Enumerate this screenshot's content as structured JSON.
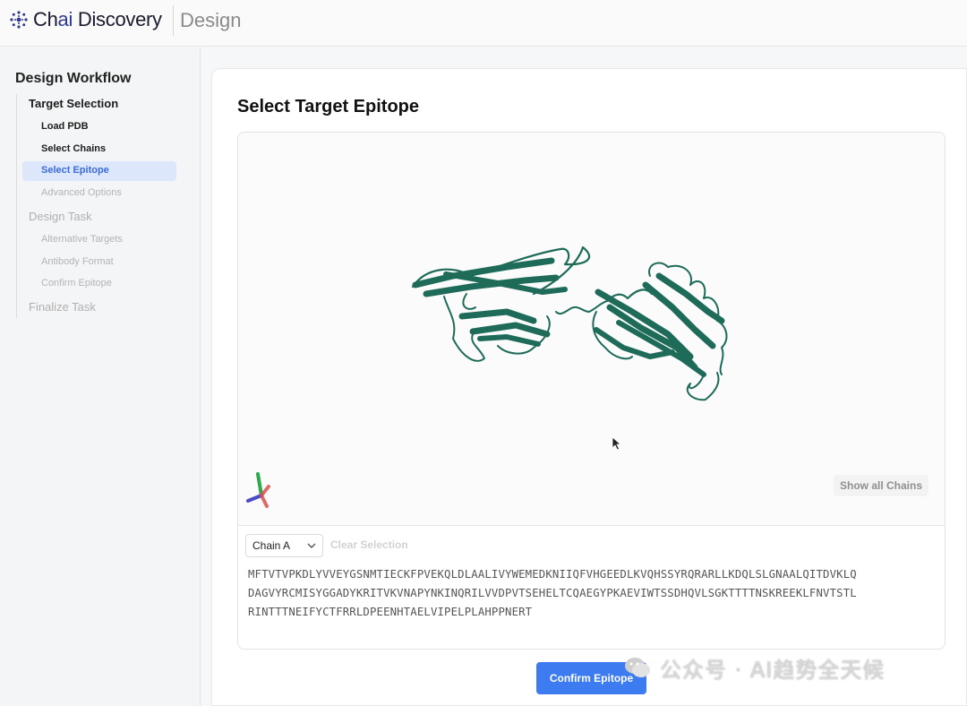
{
  "header": {
    "brand_prefix": "Ch",
    "brand_highlight": "ai",
    "brand_suffix": " Discovery",
    "section": "Design"
  },
  "sidebar": {
    "title": "Design Workflow",
    "sections": [
      {
        "label": "Target Selection",
        "state": "done"
      },
      {
        "label": "Design Task",
        "state": "pending"
      },
      {
        "label": "Finalize Task",
        "state": "pending"
      }
    ],
    "items": [
      {
        "label": "Load PDB",
        "state": "done"
      },
      {
        "label": "Select Chains",
        "state": "done"
      },
      {
        "label": "Select Epitope",
        "state": "active"
      },
      {
        "label": "Advanced Options",
        "state": "pending"
      },
      {
        "label": "Alternative Targets",
        "state": "pending"
      },
      {
        "label": "Antibody Format",
        "state": "pending"
      },
      {
        "label": "Confirm Epitope",
        "state": "pending"
      }
    ]
  },
  "main": {
    "title": "Select Target Epitope",
    "show_all_chains": "Show all Chains",
    "chain_select": "Chain A",
    "clear_selection": "Clear Selection",
    "sequence_lines": [
      "MFTVTVPKDLYVVEYGSNMTIECKFPVEKQLDLAALIVYWEMEDKNIIQFVHGEEDLKVQHSSYRQRARLLKDQLSLGNAALQITDVKLQ",
      "DAGVYRCMISYGGADYKRITVKVNAPYNKINQRILVVDPVTSEHELTCQAEGYPKAEVIWTSSDHQVLSGKTTTTNSKREEKLFNVTSTL",
      "RINTTTNEIFYCTFRRLDPEENHTAELVIPELPLAHPPNERT"
    ],
    "confirm_button": "Confirm Epitope",
    "protein_color": "#1e6b5a"
  },
  "watermark": {
    "text": "公众号 · AI趋势全天候"
  },
  "colors": {
    "accent": "#3d7bf0",
    "active_bg": "#dde7fb",
    "active_text": "#3a6bd8"
  }
}
